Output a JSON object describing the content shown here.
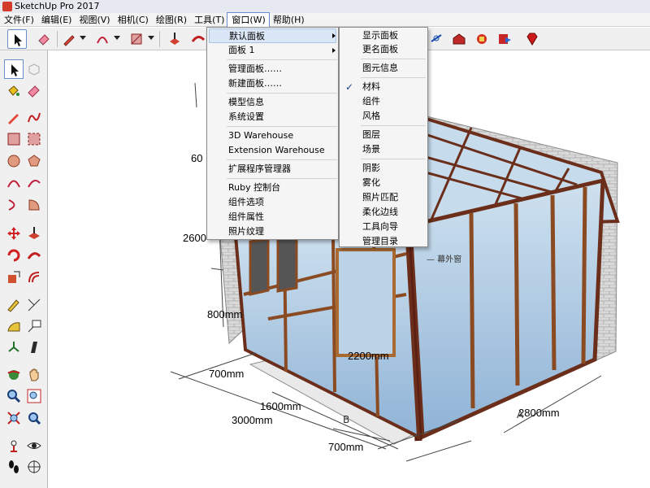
{
  "title": "SketchUp Pro 2017",
  "menubar": [
    "文件(F)",
    "编辑(E)",
    "视图(V)",
    "相机(C)",
    "绘图(R)",
    "工具(T)",
    "窗口(W)",
    "帮助(H)"
  ],
  "window_menu": {
    "items": [
      "默认面板",
      "面板 1",
      "管理面板……",
      "新建面板……",
      "模型信息",
      "系统设置",
      "3D Warehouse",
      "Extension Warehouse",
      "扩展程序管理器",
      "Ruby 控制台",
      "组件选项",
      "组件属性",
      "照片纹理"
    ]
  },
  "panel_submenu": {
    "items": [
      "显示面板",
      "更名面板",
      "图元信息",
      "材料",
      "组件",
      "风格",
      "图层",
      "场景",
      "阴影",
      "雾化",
      "照片匹配",
      "柔化边线",
      "工具向导",
      "管理目录"
    ],
    "checked_item": "材料",
    "check_glyph": "✓"
  },
  "dimensions": [
    "60",
    "2600",
    "800mm",
    "700mm",
    "1600mm",
    "3000mm",
    "700mm",
    "2200mm",
    "2800mm"
  ],
  "callouts": {
    "curtain_label": "— 幕外窗",
    "label_b": "B",
    "label_a": "A"
  }
}
